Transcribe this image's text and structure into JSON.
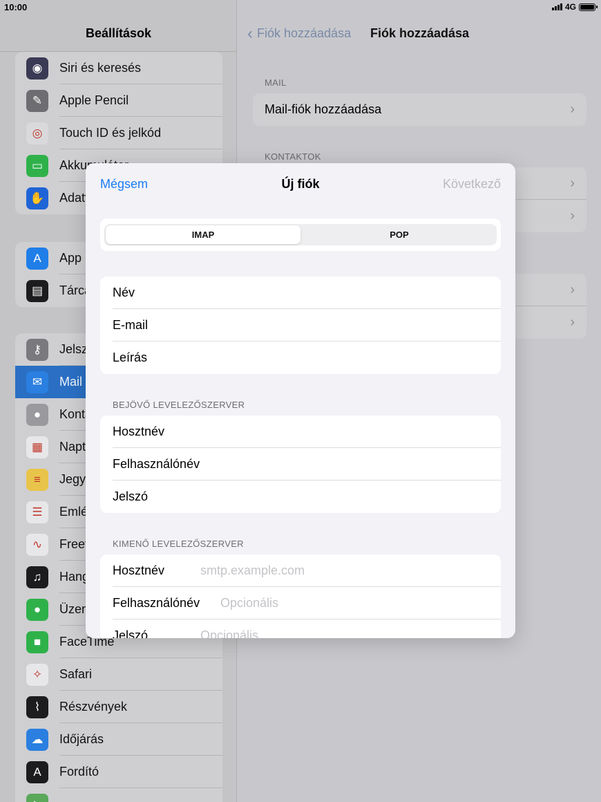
{
  "status": {
    "time": "10:00",
    "network": "4G"
  },
  "sidebar": {
    "title": "Beállítások",
    "group1": [
      {
        "label": "Siri és keresés",
        "icon": "siri-icon",
        "color": "#3a3a55"
      },
      {
        "label": "Apple Pencil",
        "icon": "pencil-icon",
        "color": "#6e6e72"
      },
      {
        "label": "Touch ID és jelkód",
        "icon": "fingerprint-icon",
        "color": "#d9d9dc"
      },
      {
        "label": "Akkumulátor",
        "icon": "battery-icon",
        "color": "#2fb14a"
      },
      {
        "label": "Adatvédelem",
        "icon": "hand-icon",
        "color": "#1f64d6"
      }
    ],
    "group2": [
      {
        "label": "App Store",
        "icon": "appstore-icon",
        "color": "#1f7ee8"
      },
      {
        "label": "Tárca",
        "icon": "wallet-icon",
        "color": "#1c1c1e"
      }
    ],
    "group3": [
      {
        "label": "Jelszavak",
        "icon": "key-icon",
        "color": "#7a7a7e"
      },
      {
        "label": "Mail",
        "icon": "mail-icon",
        "color": "#2a7fe0",
        "selected": true
      },
      {
        "label": "Kontaktok",
        "icon": "contacts-icon",
        "color": "#9a9a9e"
      },
      {
        "label": "Naptár",
        "icon": "calendar-icon",
        "color": "#e7e7ea"
      },
      {
        "label": "Jegyzetek",
        "icon": "notes-icon",
        "color": "#e9c44a"
      },
      {
        "label": "Emlékeztetők",
        "icon": "reminders-icon",
        "color": "#e7e7ea"
      },
      {
        "label": "Freeform",
        "icon": "freeform-icon",
        "color": "#e7e7ea"
      },
      {
        "label": "Hangjegyzetek",
        "icon": "voicememo-icon",
        "color": "#1c1c1e"
      },
      {
        "label": "Üzenetek",
        "icon": "messages-icon",
        "color": "#2fb14a"
      },
      {
        "label": "FaceTime",
        "icon": "facetime-icon",
        "color": "#2fb14a"
      },
      {
        "label": "Safari",
        "icon": "safari-icon",
        "color": "#e7e7ea"
      },
      {
        "label": "Részvények",
        "icon": "stocks-icon",
        "color": "#1c1c1e"
      },
      {
        "label": "Időjárás",
        "icon": "weather-icon",
        "color": "#2a7fe0"
      },
      {
        "label": "Fordító",
        "icon": "translate-icon",
        "color": "#1c1c1e"
      },
      {
        "label": "",
        "icon": "maps-icon",
        "color": "#5aa85a"
      }
    ]
  },
  "detail": {
    "back_label": "Fiók hozzáadása",
    "title": "Fiók hozzáadása",
    "section_mail": "MAIL",
    "mail_row": "Mail-fiók hozzáadása",
    "section_contacts": "KONTAKTOK"
  },
  "modal": {
    "cancel": "Mégsem",
    "title": "Új fiók",
    "next": "Következő",
    "seg_imap": "IMAP",
    "seg_pop": "POP",
    "field_name": "Név",
    "field_email": "E-mail",
    "field_desc": "Leírás",
    "incoming_header": "BEJÖVŐ LEVELEZŐSZERVER",
    "in_host": "Hosztnév",
    "in_user": "Felhasználónév",
    "in_pass": "Jelszó",
    "outgoing_header": "KIMENŐ LEVELEZŐSZERVER",
    "out_host": "Hosztnév",
    "out_host_placeholder": "smtp.example.com",
    "out_user": "Felhasználónév",
    "out_user_placeholder": "Opcionális",
    "out_pass": "Jelszó",
    "out_pass_placeholder": "Opcionális"
  }
}
